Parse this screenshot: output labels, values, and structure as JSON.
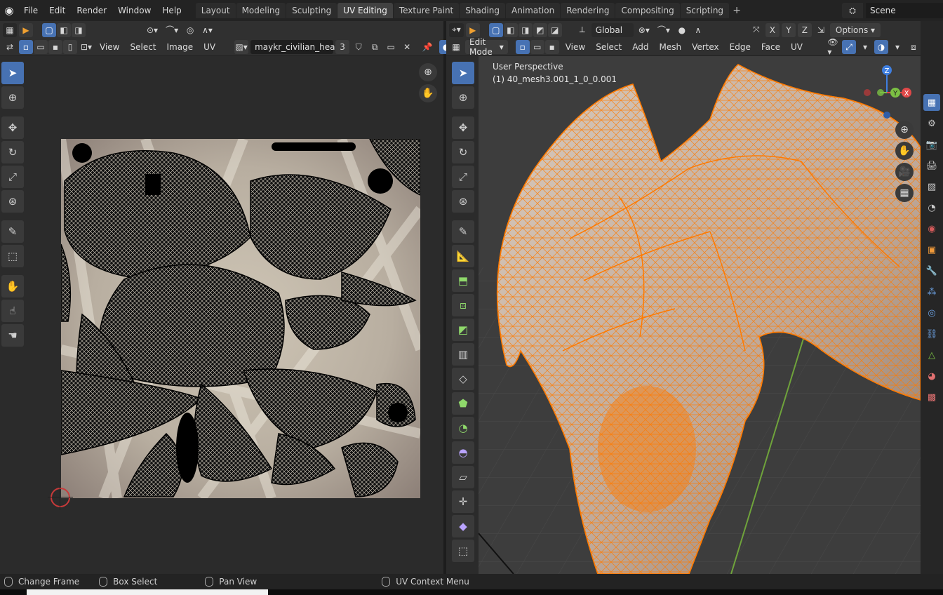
{
  "topbar": {
    "menus": [
      "File",
      "Edit",
      "Render",
      "Window",
      "Help"
    ],
    "workspaces": [
      "Layout",
      "Modeling",
      "Sculpting",
      "UV Editing",
      "Texture Paint",
      "Shading",
      "Animation",
      "Rendering",
      "Compositing",
      "Scripting"
    ],
    "active_workspace": "UV Editing",
    "scene_label": "Scene"
  },
  "uv_editor": {
    "menus": [
      "View",
      "Select",
      "Image",
      "UV"
    ],
    "image_name": "maykr_civilian_hea...",
    "image_users": "3"
  },
  "viewport": {
    "mode": "Edit Mode",
    "orientation": "Global",
    "menus": [
      "View",
      "Select",
      "Add",
      "Mesh",
      "Vertex",
      "Edge",
      "Face",
      "UV"
    ],
    "options_label": "Options",
    "axes": [
      "X",
      "Y",
      "Z"
    ],
    "view_name": "User Perspective",
    "object_name": "(1) 40_mesh3.001_1_0_0.001",
    "gizmo_labels": {
      "z": "Z",
      "y": "Y",
      "x": "X"
    }
  },
  "statusbar": {
    "items": [
      "Change Frame",
      "Box Select",
      "Pan View",
      "UV Context Menu"
    ]
  },
  "colors": {
    "accent": "#4772b3",
    "mesh_wire": "#ff7a00",
    "axis_x": "#e04848",
    "axis_y": "#7bc043",
    "axis_z": "#3f7fe0"
  }
}
